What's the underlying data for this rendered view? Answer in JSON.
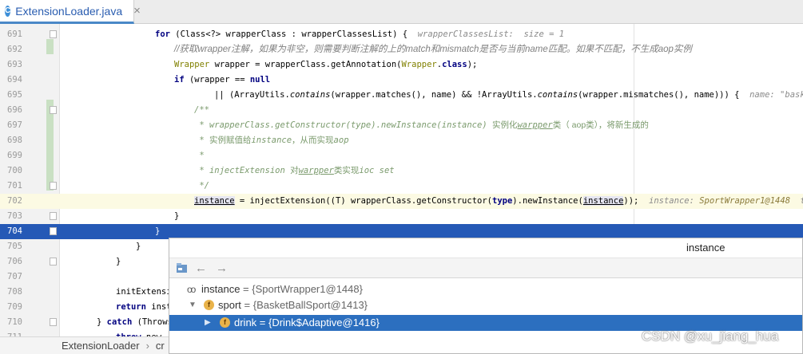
{
  "tab": {
    "title": "ExtensionLoader.java",
    "icon_letter": "C",
    "close": "×"
  },
  "editor": {
    "lines": {
      "l691": {
        "num": "691",
        "kw_for": "for",
        "a": " (Class<?> wrapperClass : wrapperClassesList) {  ",
        "hint": "wrapperClassesList:  size = 1"
      },
      "l692": {
        "num": "692",
        "comment": "//获取wrapper注解，如果为非空，则需要判断注解的上的match和mismatch是否与当前name匹配。如果不匹配，不生成aop实例"
      },
      "l693": {
        "num": "693",
        "ann1": "Wrapper",
        "a": " wrapper = wrapperClass.getAnnotation(",
        "ann2": "Wrapper",
        "b": ".",
        "kw_class": "class",
        "c": ");"
      },
      "l694": {
        "num": "694",
        "kw_if": "if",
        "a": " (wrapper == ",
        "kw_null": "null"
      },
      "l695": {
        "num": "695",
        "a": "|| (ArrayUtils.",
        "m1": "contains",
        "b": "(wrapper.matches(), name) && !ArrayUtils.",
        "m2": "contains",
        "c": "(wrapper.mismatches(), name))) {  ",
        "hint_label": "name: ",
        "hint_value": "\"basketBall"
      },
      "l696": {
        "num": "696",
        "javadoc": "/**"
      },
      "l697": {
        "num": "697",
        "jd_a": " * wrapperClass.getConstructor(type).newInstance(instance) ",
        "cn": "实例化",
        "jd_b": "warpper",
        "cn2": "类（ aop类），将新生成的"
      },
      "l698": {
        "num": "698",
        "star": " * ",
        "cn": "实例赋值给",
        "jd_a": "instance",
        "cn2": "，从而实现",
        "jd_b": "aop"
      },
      "l699": {
        "num": "699",
        "javadoc": " *"
      },
      "l700": {
        "num": "700",
        "jd_a": " * injectExtension ",
        "cn": "对",
        "jd_b": "warpper",
        "cn2": "类实现",
        "jd_c": "ioc set"
      },
      "l701": {
        "num": "701",
        "javadoc": " */"
      },
      "l702": {
        "num": "702",
        "var": "instance",
        "a": " = injectExtension((",
        "t": "T",
        "b": ") wrapperClass.getConstructor(",
        "kw_type": "type",
        "c": ").newInstance(",
        "var2": "instance",
        "d": ")); ",
        "hint_label": " instance: ",
        "hint_value": "SportWrapper1@1448",
        "hint_label2": "  type: ",
        "hint_value2": "\""
      },
      "l703": {
        "num": "703",
        "brace": "}"
      },
      "l704": {
        "num": "704",
        "brace": "}"
      },
      "l705": {
        "num": "705",
        "brace": "}"
      },
      "l706": {
        "num": "706",
        "brace": "}"
      },
      "l707": {
        "num": "707"
      },
      "l708": {
        "num": "708",
        "a": "initExtensi"
      },
      "l709": {
        "num": "709",
        "kw_return": "return",
        "a": " inst"
      },
      "l710": {
        "num": "710",
        "a": "} ",
        "kw_catch": "catch",
        "b": " (Throws"
      },
      "l711": {
        "num": "711",
        "kw_throw": "throw",
        "a": " new "
      }
    }
  },
  "breadcrumb": {
    "class_name": "ExtensionLoader",
    "separator": "›",
    "method": "cr"
  },
  "popup": {
    "title": "instance",
    "toolbar": {
      "back": "←",
      "forward": "→"
    },
    "rows": [
      {
        "glyph": "oo",
        "label": "instance",
        "value": " = {SportWrapper1@1448}"
      },
      {
        "arrow": "▼",
        "icon": "f",
        "label": "sport",
        "value": " = {BasketBallSport@1413}"
      },
      {
        "arrow": "▶",
        "icon": "f",
        "label": "drink",
        "value": " = {Drink$Adaptive@1416}"
      }
    ]
  },
  "watermark": "CSDN @xu_jiang_hua",
  "colors": {
    "selection": "#2559b6",
    "popup_selection": "#2c6fbf",
    "current_line": "#fcfae3",
    "change_marker": "#c9e0c3"
  }
}
